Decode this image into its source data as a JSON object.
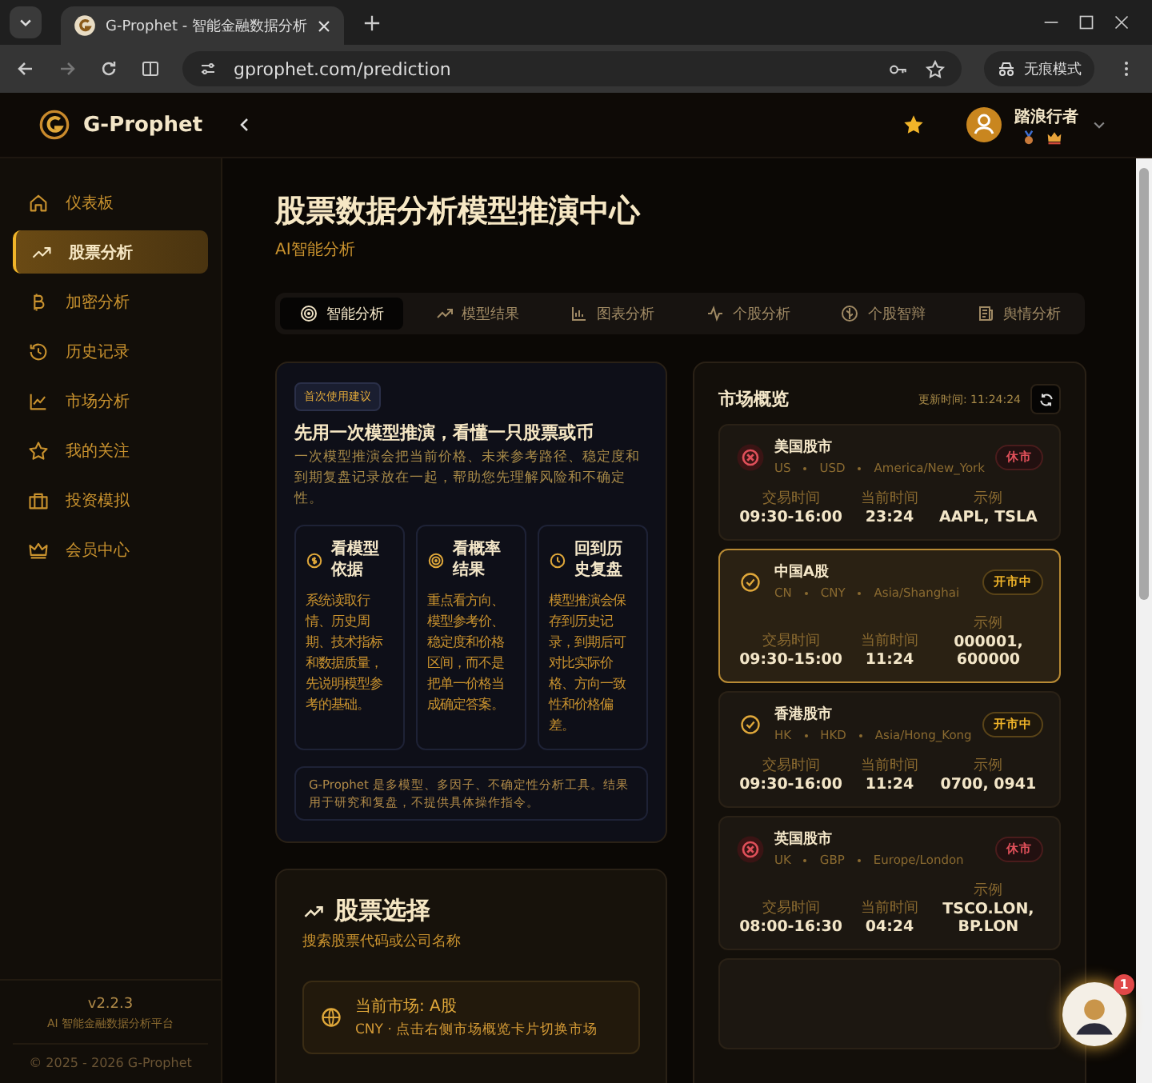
{
  "browser": {
    "tab_title": "G-Prophet - 智能金融数据分析",
    "url": "gprophet.com/prediction",
    "incognito_label": "无痕模式"
  },
  "header": {
    "brand": "G-Prophet",
    "user_name": "踏浪行者"
  },
  "sidebar": {
    "items": [
      {
        "label": "仪表板",
        "selected": false
      },
      {
        "label": "股票分析",
        "selected": true
      },
      {
        "label": "加密分析",
        "selected": false
      },
      {
        "label": "历史记录",
        "selected": false
      },
      {
        "label": "市场分析",
        "selected": false
      },
      {
        "label": "我的关注",
        "selected": false
      },
      {
        "label": "投资模拟",
        "selected": false
      },
      {
        "label": "会员中心",
        "selected": false
      }
    ],
    "version": "v2.2.3",
    "tagline": "AI 智能金融数据分析平台",
    "copyright": "© 2025 - 2026 G-Prophet"
  },
  "page": {
    "title": "股票数据分析模型推演中心",
    "subtitle": "AI智能分析"
  },
  "tabs": [
    {
      "label": "智能分析",
      "selected": true
    },
    {
      "label": "模型结果",
      "selected": false
    },
    {
      "label": "图表分析",
      "selected": false
    },
    {
      "label": "个股分析",
      "selected": false
    },
    {
      "label": "个股智辩",
      "selected": false
    },
    {
      "label": "舆情分析",
      "selected": false
    }
  ],
  "intro": {
    "badge": "首次使用建议",
    "heading": "先用一次模型推演，看懂一只股票或币",
    "text": "一次模型推演会把当前价格、未来参考路径、稳定度和到期复盘记录放在一起，帮助您先理解风险和不确定性。",
    "tips": [
      {
        "title": "看模型依据",
        "text": "系统读取行情、历史周期、技术指标和数据质量，先说明模型参考的基础。"
      },
      {
        "title": "看概率结果",
        "text": "重点看方向、模型参考价、稳定度和价格区间，而不是把单一价格当成确定答案。"
      },
      {
        "title": "回到历史复盘",
        "text": "模型推演会保存到历史记录，到期后可对比实际价格、方向一致性和价格偏差。"
      }
    ],
    "disclaimer": "G-Prophet 是多模型、多因子、不确定性分析工具。结果用于研究和复盘，不提供具体操作指令。"
  },
  "market": {
    "title": "市场概览",
    "updated": "更新时间: 11:24:24",
    "cards": [
      {
        "name": "美国股市",
        "code": "US",
        "currency": "USD",
        "timezone": "America/New_York",
        "open": false,
        "status": "休市",
        "selected": false,
        "hours_label": "交易时间",
        "hours": "09:30-16:00",
        "now_label": "当前时间",
        "now": "23:24",
        "example_label": "示例",
        "examples": "AAPL, TSLA"
      },
      {
        "name": "中国A股",
        "code": "CN",
        "currency": "CNY",
        "timezone": "Asia/Shanghai",
        "open": true,
        "status": "开市中",
        "selected": true,
        "hours_label": "交易时间",
        "hours": "09:30-15:00",
        "now_label": "当前时间",
        "now": "11:24",
        "example_label": "示例",
        "examples": "000001, 600000"
      },
      {
        "name": "香港股市",
        "code": "HK",
        "currency": "HKD",
        "timezone": "Asia/Hong_Kong",
        "open": true,
        "status": "开市中",
        "selected": false,
        "hours_label": "交易时间",
        "hours": "09:30-16:00",
        "now_label": "当前时间",
        "now": "11:24",
        "example_label": "示例",
        "examples": "0700, 0941"
      },
      {
        "name": "英国股市",
        "code": "UK",
        "currency": "GBP",
        "timezone": "Europe/London",
        "open": false,
        "status": "休市",
        "selected": false,
        "hours_label": "交易时间",
        "hours": "08:00-16:30",
        "now_label": "当前时间",
        "now": "04:24",
        "example_label": "示例",
        "examples": "TSCO.LON, BP.LON"
      }
    ]
  },
  "stock_select": {
    "title": "股票选择",
    "subtitle": "搜索股票代码或公司名称",
    "current_market": "当前市场: A股",
    "hint": "CNY · 点击右侧市场概览卡片切换市场"
  },
  "chat": {
    "badge": "1"
  }
}
